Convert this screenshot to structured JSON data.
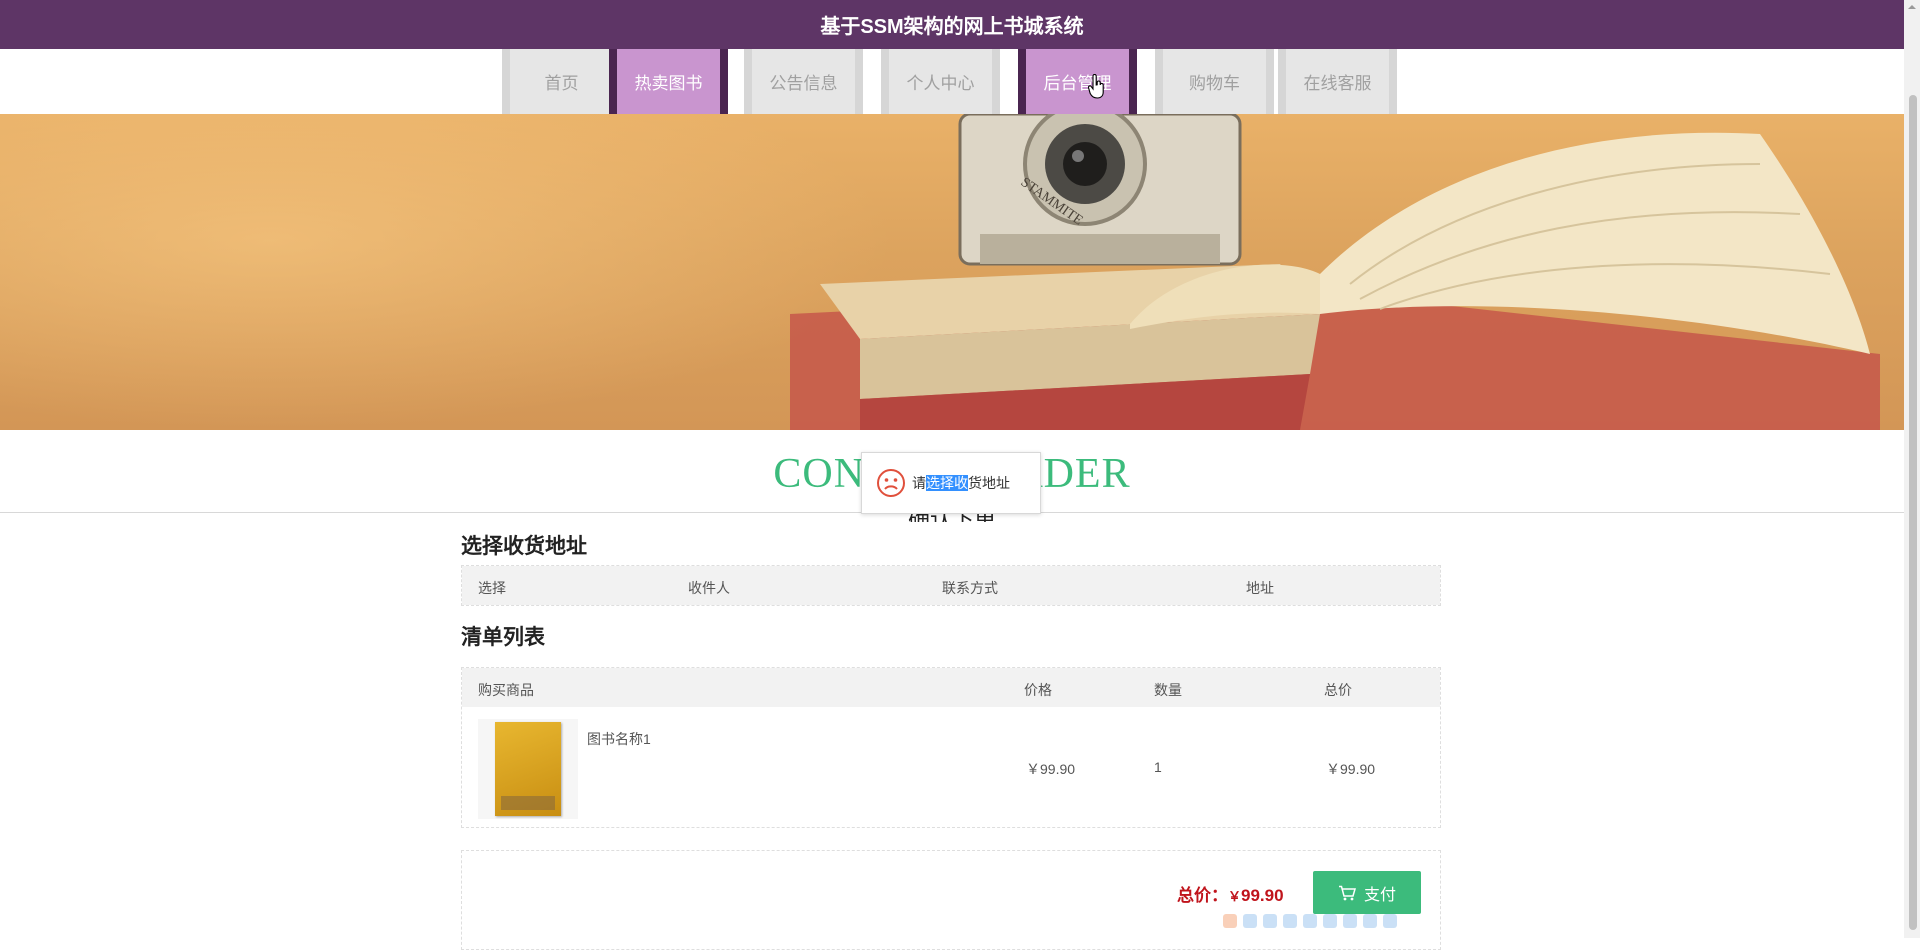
{
  "header": {
    "title": "基于SSM架构的网上书城系统"
  },
  "nav": {
    "items": [
      {
        "label": "首页",
        "active": false
      },
      {
        "label": "热卖图书",
        "active": true
      },
      {
        "label": "公告信息",
        "active": false
      },
      {
        "label": "个人中心",
        "active": false
      },
      {
        "label": "后台管理",
        "active": true
      },
      {
        "label": "购物车",
        "active": false
      },
      {
        "label": "在线客服",
        "active": false
      }
    ]
  },
  "page": {
    "title_en": "CONFIRM ORDER",
    "title_cn": "确认下单"
  },
  "toast": {
    "text_before": "请",
    "text_selected": "选择收",
    "text_after": "货地址"
  },
  "address": {
    "heading": "选择收货地址",
    "columns": [
      "选择",
      "收件人",
      "联系方式",
      "地址"
    ]
  },
  "items": {
    "heading": "清单列表",
    "columns": [
      "购买商品",
      "价格",
      "数量",
      "总价"
    ],
    "rows": [
      {
        "name": "图书名称1",
        "price": "￥99.90",
        "qty": "1",
        "total": "￥99.90"
      }
    ]
  },
  "summary": {
    "label": "总价：",
    "currency": "￥",
    "amount": "99.90",
    "pay_label": "支付"
  },
  "colors": {
    "header_bg": "#5e3566",
    "nav_active_bg": "#c995cf",
    "accent_green": "#3cbb7c",
    "price_red": "#c0141c"
  }
}
